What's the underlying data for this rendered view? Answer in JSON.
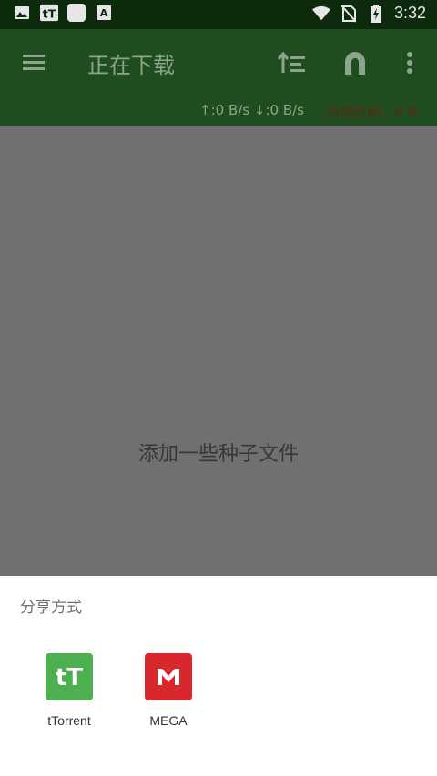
{
  "statusbar": {
    "time": "3:32",
    "left_icons": [
      "image-icon",
      "ttorrent-notification-icon",
      "white-square-icon",
      "font-app-icon"
    ],
    "right_icons": [
      "wifi-icon",
      "no-sim-icon",
      "battery-charging-icon"
    ]
  },
  "toolbar": {
    "title": "正在下载",
    "background": "#1f4d1f"
  },
  "speedbar": {
    "speed_text": "↑:0 B/s ↓:0 B/s",
    "free_space": "可用空间：0 B"
  },
  "content": {
    "empty_message": "添加一些种子文件"
  },
  "sheet": {
    "title": "分享方式",
    "apps": [
      {
        "label": "tTorrent",
        "icon": "ttorrent-icon",
        "color": "#4caf50"
      },
      {
        "label": "MEGA",
        "icon": "mega-icon",
        "color": "#d9272e"
      }
    ]
  }
}
